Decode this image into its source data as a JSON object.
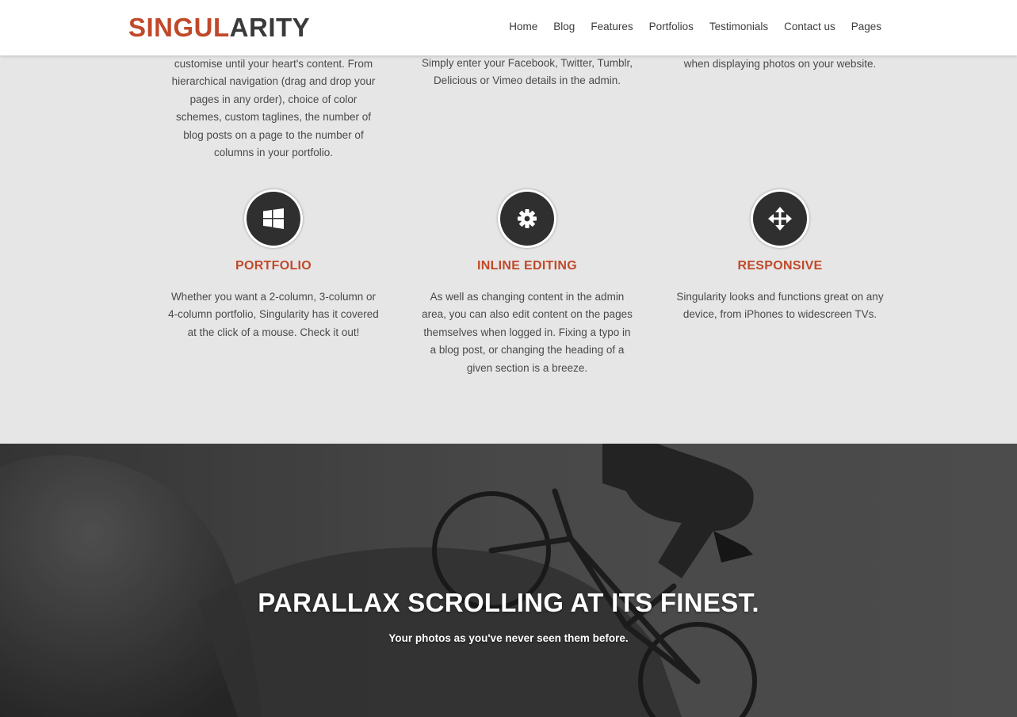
{
  "header": {
    "logo_part1": "SINGUL",
    "logo_part2": "ARITY",
    "nav": [
      "Home",
      "Blog",
      "Features",
      "Portfolios",
      "Testimonials",
      "Contact us",
      "Pages"
    ]
  },
  "features_top": [
    "customise until your heart's content. From hierarchical navigation (drag and drop your pages in any order), choice of color schemes, custom taglines, the number of blog posts on a page to the number of columns in your portfolio.",
    "Simply enter your Facebook, Twitter, Tumblr, Delicious or Vimeo details in the admin.",
    "when displaying photos on your website."
  ],
  "features": [
    {
      "icon": "windows-icon",
      "title": "PORTFOLIO",
      "text": "Whether you want a 2-column, 3-column or 4-column portfolio, Singularity has it covered at the click of a mouse. Check it out!"
    },
    {
      "icon": "gear-icon",
      "title": "INLINE EDITING",
      "text": "As well as changing content in the admin area, you can also edit content on the pages themselves when logged in. Fixing a typo in a blog post, or changing the heading of a given section is a breeze."
    },
    {
      "icon": "move-arrows-icon",
      "title": "RESPONSIVE",
      "text": "Singularity looks and functions great on any device, from iPhones to widescreen TVs."
    }
  ],
  "parallax": {
    "title": "PARALLAX SCROLLING AT ITS FINEST.",
    "subtitle": "Your photos as you've never seen them before."
  },
  "colors": {
    "accent": "#c0492a",
    "dark": "#3a3a3a",
    "section_bg": "#e6e6e6",
    "icon_bg": "#2f2f2f"
  }
}
